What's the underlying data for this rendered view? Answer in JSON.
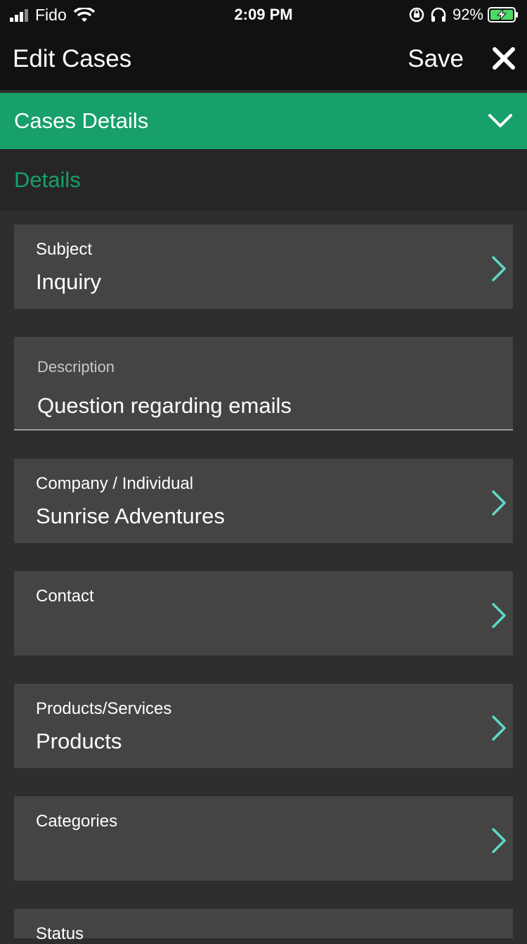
{
  "status_bar": {
    "carrier": "Fido",
    "time": "2:09 PM",
    "battery": "92%"
  },
  "nav": {
    "title": "Edit Cases",
    "save_label": "Save"
  },
  "section": {
    "title": "Cases Details"
  },
  "group": {
    "title": "Details"
  },
  "fields": {
    "subject": {
      "label": "Subject",
      "value": "Inquiry"
    },
    "description": {
      "label": "Description",
      "value": "Question regarding emails"
    },
    "company": {
      "label": "Company / Individual",
      "value": "Sunrise Adventures"
    },
    "contact": {
      "label": "Contact",
      "value": ""
    },
    "products": {
      "label": "Products/Services",
      "value": "Products"
    },
    "categories": {
      "label": "Categories",
      "value": ""
    },
    "status": {
      "label": "Status",
      "value": ""
    }
  },
  "colors": {
    "accent": "#17a06a",
    "chevron": "#5fd8c8",
    "field_bg": "#444444",
    "bar_bg": "#111111"
  }
}
